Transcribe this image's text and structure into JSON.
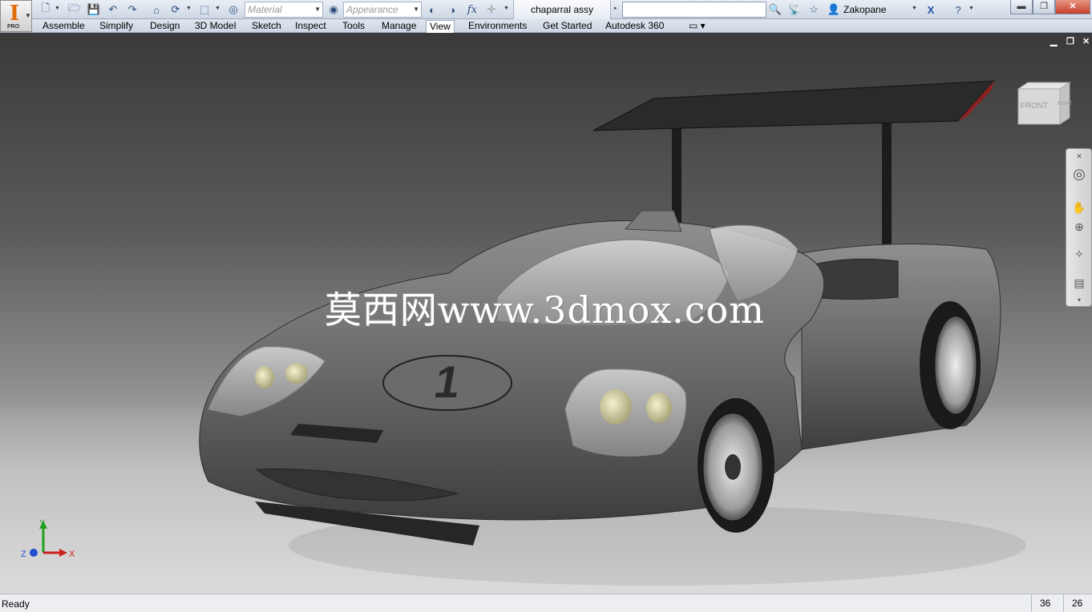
{
  "app": {
    "logo_letter": "I",
    "logo_badge": "PRO",
    "document_title": "chaparral assy",
    "search_value": "",
    "user_name": "Zakopane"
  },
  "quick_access": {
    "material_combo": "Material",
    "appearance_combo": "Appearance",
    "fx_label": "fx"
  },
  "ribbon_tabs": [
    "Assemble",
    "Simplify",
    "Design",
    "3D Model",
    "Sketch",
    "Inspect",
    "Tools",
    "Manage",
    "View",
    "Environments",
    "Get Started",
    "Autodesk 360"
  ],
  "active_tab": "View",
  "viewport": {
    "watermark": "莫西网www.3dmox.com",
    "car_number": "1",
    "viewcube": {
      "front": "FRONT",
      "right": "RIGHT"
    },
    "triad": {
      "x": "X",
      "y": "Y",
      "z": "Z"
    }
  },
  "statusbar": {
    "status": "Ready",
    "count_a": "36",
    "count_b": "26"
  },
  "colors": {
    "accent_orange": "#e46c0a",
    "axis_x": "#cc2020",
    "axis_y": "#22a022",
    "axis_z": "#2050d0"
  },
  "icons": [
    "new-icon",
    "open-icon",
    "save-icon",
    "undo-icon",
    "redo-icon",
    "home-icon",
    "select-icon",
    "color-icon",
    "search-icon",
    "star-icon",
    "help-icon"
  ]
}
